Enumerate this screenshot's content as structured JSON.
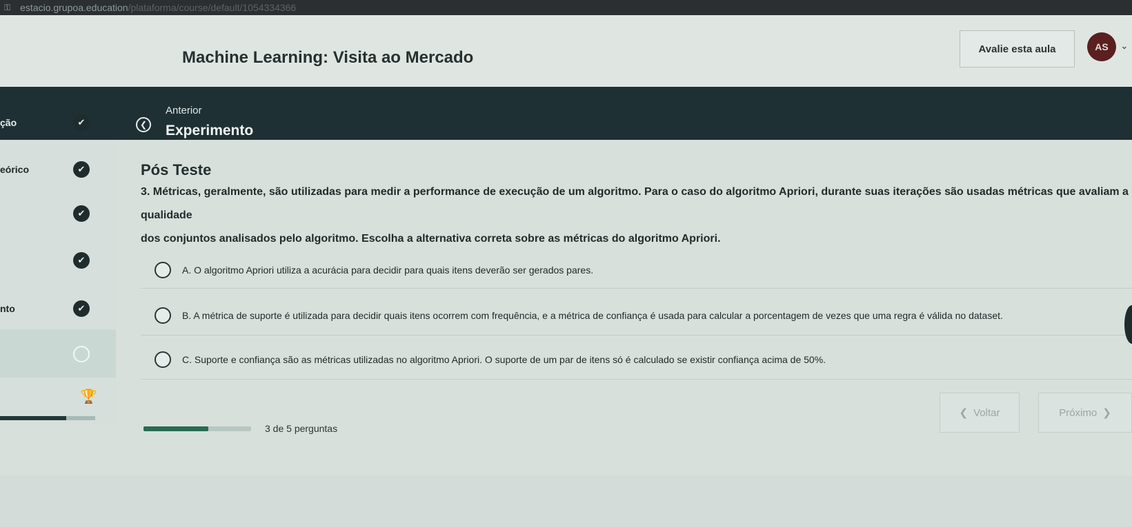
{
  "browser": {
    "url": "estacio.grupoa.education",
    "url_path": "/plataforma/course/default/1054334366"
  },
  "header": {
    "course_title": "Machine Learning: Visita ao Mercado",
    "rate_button": "Avalie esta aula",
    "avatar_initials": "AS"
  },
  "lessonbar": {
    "prev_label": "Anterior",
    "lesson_name": "Experimento"
  },
  "sidebar": {
    "items": [
      {
        "label": "ção",
        "status": "done"
      },
      {
        "label": "eórico",
        "status": "done"
      },
      {
        "label": "",
        "status": "done"
      },
      {
        "label": "",
        "status": "done"
      },
      {
        "label": "nto",
        "status": "done"
      },
      {
        "label": "",
        "status": "current"
      }
    ]
  },
  "content": {
    "section_title": "Pós Teste",
    "question": "3. Métricas, geralmente, são utilizadas para medir a performance de execução de um algoritmo. Para o caso do algoritmo Apriori, durante suas iterações são usadas métricas que avaliam a qualidade\ndos conjuntos analisados pelo algoritmo. Escolha a alternativa correta sobre as métricas do algoritmo Apriori.",
    "options": [
      {
        "text": "A. O algoritmo Apriori utiliza a acurácia para decidir para quais itens deverão ser gerados pares."
      },
      {
        "text": "B. A métrica de suporte é utilizada para decidir quais itens ocorrem com frequência, e a métrica de confiança é usada para calcular a porcentagem de vezes que uma regra é válida no dataset."
      },
      {
        "text": "C. Suporte e confiança são as métricas utilizadas no algoritmo Apriori. O suporte de um par de itens só é calculado se existir confiança acima de 50%."
      }
    ],
    "progress_text": "3 de 5 perguntas",
    "progress_fraction": 0.6,
    "back_button": "Voltar",
    "next_button": "Próximo"
  },
  "icons": {
    "lock": "⚿",
    "check": "✔",
    "prev": "❮",
    "chevron": "⌄",
    "trophy": "🏆",
    "back": "❮",
    "next": "❯"
  }
}
